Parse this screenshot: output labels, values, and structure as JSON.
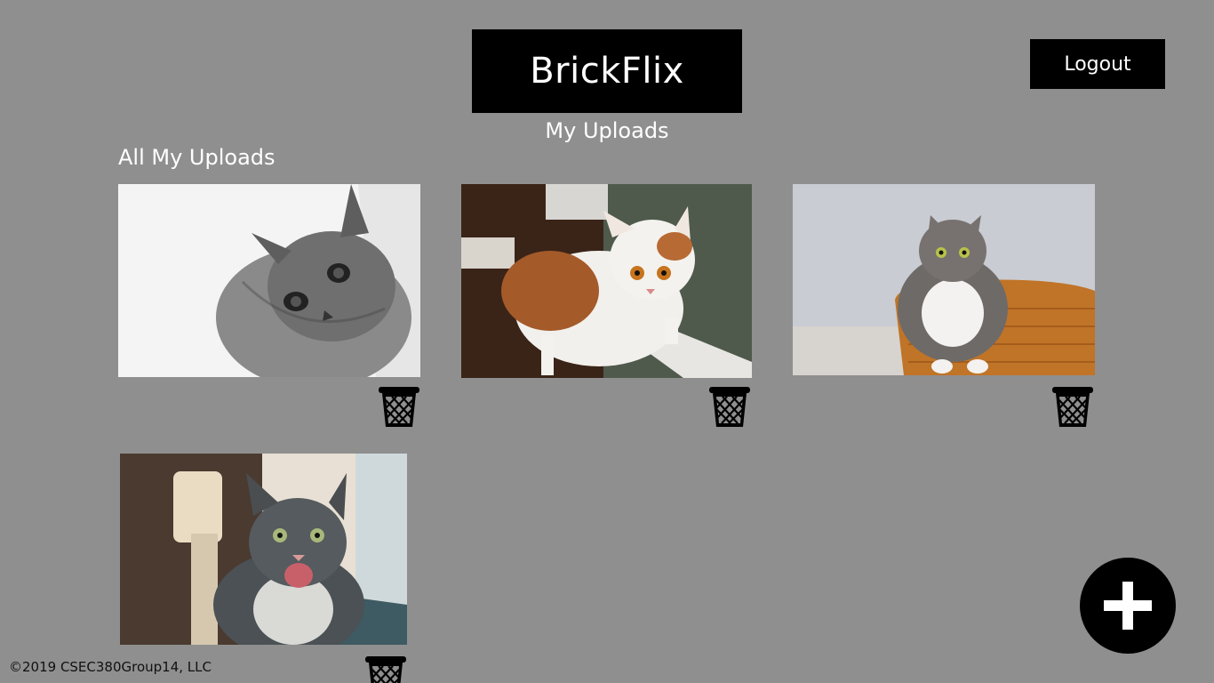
{
  "header": {
    "brand": "BrickFlix",
    "subtitle": "My Uploads",
    "logout_label": "Logout"
  },
  "main": {
    "heading": "All My Uploads",
    "uploads": [
      {
        "subject": "black-and-white kitten"
      },
      {
        "subject": "white and orange cat at window"
      },
      {
        "subject": "gray tabby cat in wicker basket"
      },
      {
        "subject": "tabby cat meowing"
      }
    ]
  },
  "actions": {
    "delete_icon": "trash-icon",
    "add_icon": "plus-icon"
  },
  "footer": {
    "copyright": "©2019 CSEC380Group14, LLC"
  },
  "colors": {
    "background": "#8f8f8f",
    "brand_bg": "#000000",
    "text": "#ffffff"
  }
}
